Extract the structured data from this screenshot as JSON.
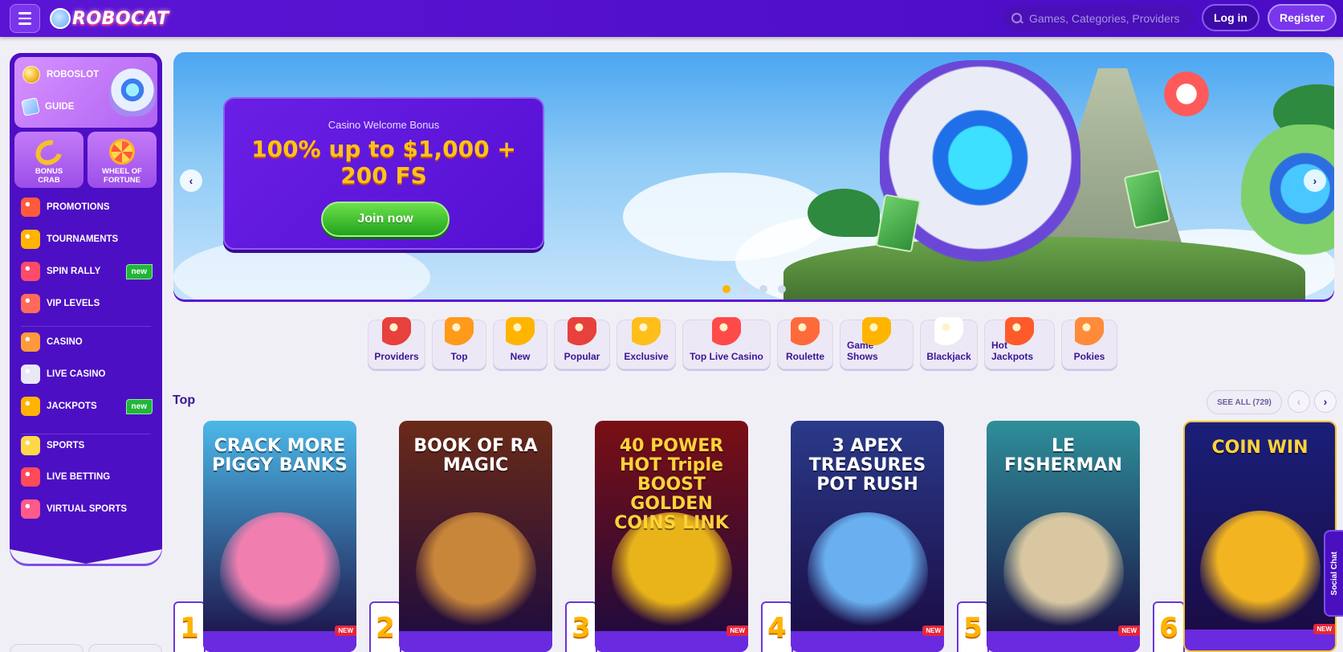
{
  "header": {
    "logo_text": "ROBOCAT",
    "search_placeholder": "Games, Categories, Providers",
    "login_label": "Log in",
    "register_label": "Register"
  },
  "sidebar": {
    "promo": [
      {
        "label": "ROBOSLOT",
        "icon": "coin-icon"
      },
      {
        "label": "GUIDE",
        "icon": "guide-icon"
      }
    ],
    "tiles": [
      {
        "label": "BONUS CRAB",
        "icon": "bonus-crab-icon"
      },
      {
        "label": "WHEEL OF FORTUNE",
        "icon": "wheel-of-fortune-icon"
      }
    ],
    "items": [
      {
        "label": "PROMOTIONS",
        "icon": "gift-icon",
        "color": "#ff5a3c"
      },
      {
        "label": "TOURNAMENTS",
        "icon": "trophy-icon",
        "color": "#ffb400"
      },
      {
        "label": "SPIN RALLY",
        "icon": "spin-rally-icon",
        "color": "#ff4a6a",
        "badge": "new"
      },
      {
        "label": "VIP LEVELS",
        "icon": "vip-icon",
        "color": "#ff6a5a"
      },
      {
        "label": "CASINO",
        "icon": "slot-icon",
        "color": "#ff9a3c"
      },
      {
        "label": "LIVE CASINO",
        "icon": "cards-icon",
        "color": "#e8e8f6"
      },
      {
        "label": "JACKPOTS",
        "icon": "jackpot-icon",
        "color": "#ffb400",
        "badge": "new"
      },
      {
        "label": "SPORTS",
        "icon": "ball-icon",
        "color": "#ffd84a"
      },
      {
        "label": "LIVE BETTING",
        "icon": "live-betting-icon",
        "color": "#ff4a5a"
      },
      {
        "label": "VIRTUAL SPORTS",
        "icon": "vr-icon",
        "color": "#ff5a8a"
      }
    ]
  },
  "banner": {
    "subtitle": "Casino Welcome Bonus",
    "title": "100% up to $1,000 + 200 FS",
    "cta_label": "Join now",
    "prev_arrow": "‹",
    "next_arrow": "›",
    "slides_count": 4,
    "active_slide": 1
  },
  "categories": [
    {
      "label": "Providers",
      "icon": "providers-icon",
      "color": "#e8403c"
    },
    {
      "label": "Top",
      "icon": "top-medal-icon",
      "color": "#ff9a1a"
    },
    {
      "label": "New",
      "icon": "bell-icon",
      "color": "#ffb400"
    },
    {
      "label": "Popular",
      "icon": "star-icon",
      "color": "#e8403c"
    },
    {
      "label": "Exclusive",
      "icon": "gold-icon",
      "color": "#ffbe1a"
    },
    {
      "label": "Top Live Casino",
      "icon": "chip-icon",
      "color": "#ff4a4a"
    },
    {
      "label": "Roulette",
      "icon": "roulette-icon",
      "color": "#ff6a3a"
    },
    {
      "label": "Game Shows",
      "icon": "game-show-icon",
      "color": "#ffb400"
    },
    {
      "label": "Blackjack",
      "icon": "blackjack-icon",
      "color": "#ffffff"
    },
    {
      "label": "Hot Jackpots",
      "icon": "hot-jackpot-icon",
      "color": "#ff5a2a"
    },
    {
      "label": "Pokies",
      "icon": "pokies-icon",
      "color": "#ff8a3a"
    }
  ],
  "top_section": {
    "title": "Top",
    "see_all_label": "SEE ALL (729)",
    "prev_arrow": "‹",
    "next_arrow": "›"
  },
  "games": [
    {
      "rank": "1",
      "title": "CRACK MORE PIGGY BANKS",
      "badge": "NEW",
      "bg": "#4bb8e8",
      "accent": "#f07fb0"
    },
    {
      "rank": "2",
      "title": "BOOK OF RA MAGIC",
      "badge": "",
      "bg": "#6a2a18",
      "accent": "#c8863a"
    },
    {
      "rank": "3",
      "title": "40 POWER HOT Triple BOOST GOLDEN COINS LINK",
      "badge": "NEW",
      "bg": "#7a0f14",
      "accent": "#e8b41a"
    },
    {
      "rank": "4",
      "title": "3 APEX TREASURES POT RUSH",
      "badge": "NEW",
      "bg": "#2a3a8a",
      "accent": "#6ab0f0"
    },
    {
      "rank": "5",
      "title": "LE FISHERMAN",
      "badge": "NEW",
      "bg": "#2e8f9a",
      "accent": "#d8c7a0"
    },
    {
      "rank": "6",
      "title": "COIN WIN",
      "badge": "NEW",
      "bg": "#1a1f7a",
      "accent": "#f2b420"
    }
  ],
  "social_chat_label": "Social Chat"
}
